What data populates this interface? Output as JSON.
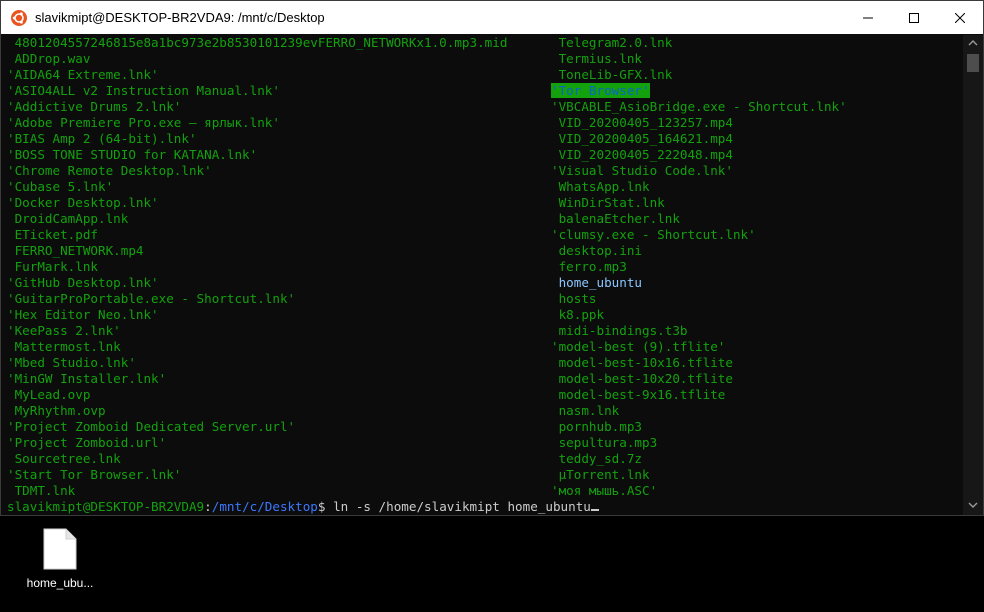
{
  "window": {
    "title": "slavikmipt@DESKTOP-BR2VDA9: /mnt/c/Desktop"
  },
  "terminal": {
    "left_column": [
      " 4801204557246815e8a1bc973e2b8530101239evFERRO_NETWORKx1.0.mp3.mid",
      " ADDrop.wav",
      "'AIDA64 Extreme.lnk'",
      "'ASIO4ALL v2 Instruction Manual.lnk'",
      "'Addictive Drums 2.lnk'",
      "'Adobe Premiere Pro.exe — ярлык.lnk'",
      "'BIAS Amp 2 (64-bit).lnk'",
      "'BOSS TONE STUDIO for KATANA.lnk'",
      "'Chrome Remote Desktop.lnk'",
      "'Cubase 5.lnk'",
      "'Docker Desktop.lnk'",
      " DroidCamApp.lnk",
      " ETicket.pdf",
      " FERRO_NETWORK.mp4",
      " FurMark.lnk",
      "'GitHub Desktop.lnk'",
      "'GuitarProPortable.exe - Shortcut.lnk'",
      "'Hex Editor Neo.lnk'",
      "'KeePass 2.lnk'",
      " Mattermost.lnk",
      "'Mbed Studio.lnk'",
      "'MinGW Installer.lnk'",
      " MyLead.ovp",
      " MyRhythm.ovp",
      "'Project Zomboid Dedicated Server.url'",
      "'Project Zomboid.url'",
      " Sourcetree.lnk",
      "'Start Tor Browser.lnk'",
      " TDMT.lnk"
    ],
    "right_column": [
      " Telegram2.0.lnk",
      " Termius.lnk",
      " ToneLib-GFX.lnk",
      "'Tor Browser'",
      "'VBCABLE_AsioBridge.exe - Shortcut.lnk'",
      " VID_20200405_123257.mp4",
      " VID_20200405_164621.mp4",
      " VID_20200405_222048.mp4",
      "'Visual Studio Code.lnk'",
      " WhatsApp.lnk",
      " WinDirStat.lnk",
      " balenaEtcher.lnk",
      "'clumsy.exe - Shortcut.lnk'",
      " desktop.ini",
      " ferro.mp3",
      " home_ubuntu",
      " hosts",
      " k8.ppk",
      " midi-bindings.t3b",
      "'model-best (9).tflite'",
      " model-best-10x16.tflite",
      " model-best-10x20.tflite",
      " model-best-9x16.tflite",
      " nasm.lnk",
      " pornhub.mp3",
      " sepultura.mp3",
      " teddy_sd.7z",
      " µTorrent.lnk",
      "'моя мышь.ASC'"
    ],
    "highlighted_right_index": 3,
    "directory_right_index": 15,
    "prompt": {
      "user_host": "slavikmipt@DESKTOP-BR2VDA9",
      "separator": ":",
      "path": "/mnt/c/Desktop",
      "symbol": "$",
      "command": " ln -s /home/slavikmipt home_ubuntu"
    }
  },
  "desktop": {
    "icon_label": "home_ubu...",
    "icon_type": "file-icon"
  },
  "colors": {
    "terminal_bg": "#0c0c0c",
    "text_green": "#13a10e",
    "path_blue": "#3b78ff",
    "dir_blue": "#8cc6ff",
    "ubuntu_orange": "#e95420"
  }
}
